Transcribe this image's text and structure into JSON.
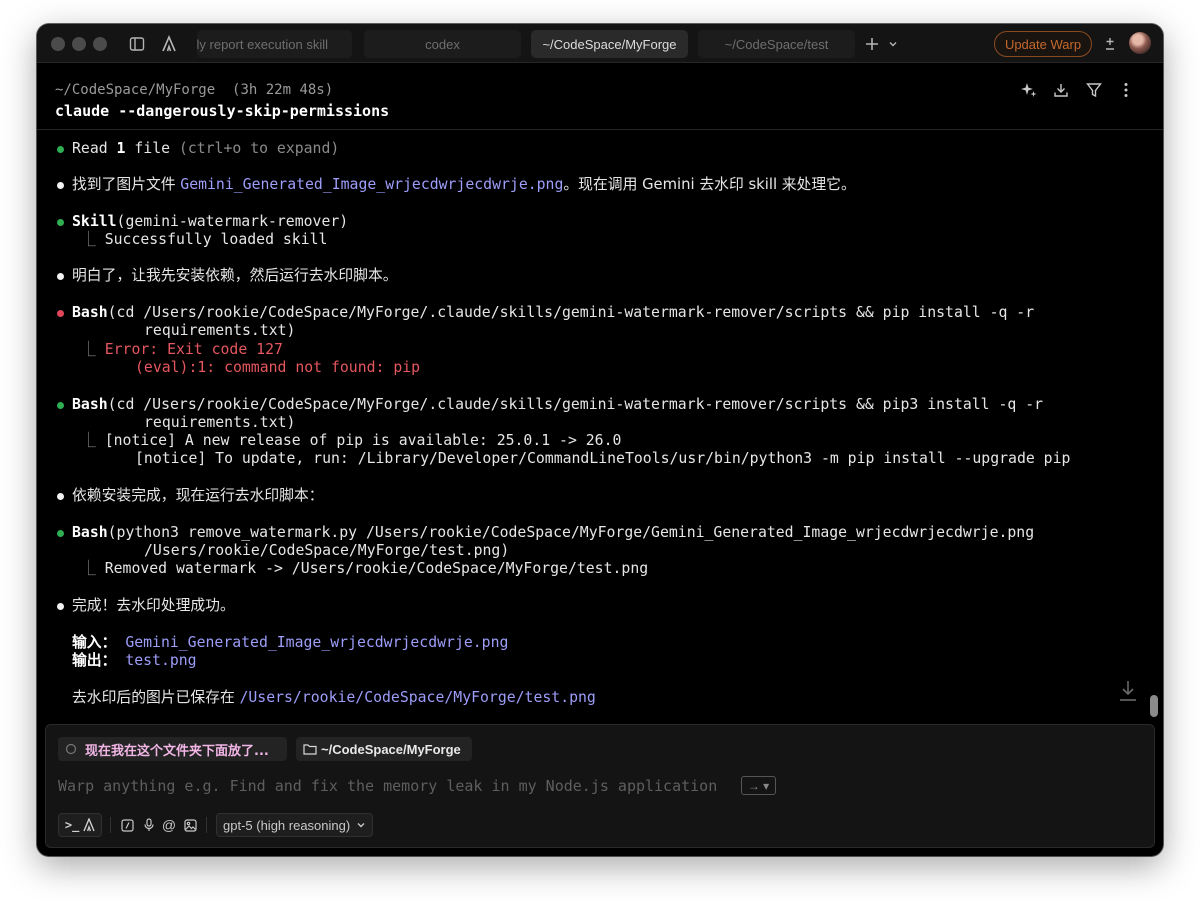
{
  "tabs": [
    {
      "label": "Daily report execution skill"
    },
    {
      "label": "codex"
    },
    {
      "label": "~/CodeSpace/MyForge"
    },
    {
      "label": "~/CodeSpace/test"
    }
  ],
  "titlebar": {
    "update_label": "Update Warp",
    "icons": [
      "sidebar-icon",
      "warp-logo-icon",
      "plus-icon",
      "chevron-down-icon",
      "plus-minus-icon",
      "avatar"
    ]
  },
  "block": {
    "path": "~/CodeSpace/MyForge",
    "duration": "(3h 22m 48s)",
    "command": "claude --dangerously-skip-permissions",
    "actions": [
      "sparkle-icon",
      "download-icon",
      "filter-icon",
      "more-vertical-icon"
    ]
  },
  "output": {
    "read": {
      "prefix": "Read ",
      "count": "1",
      "file_word": " file",
      "hint": " (ctrl+o to expand)"
    },
    "found": {
      "text": "找到了图片文件 ",
      "file": "Gemini_Generated_Image_wrjecdwrjecdwrje.png",
      "rest": "。现在调用 Gemini 去水印 skill 来处理它。"
    },
    "skill": {
      "name": "Skill",
      "arg": "(gemini-watermark-remover)",
      "result": "Successfully loaded skill"
    },
    "understand": "明白了，让我先安装依赖，然后运行去水印脚本。",
    "bash1": {
      "name": "Bash",
      "cmd1": "(cd /Users/rookie/CodeSpace/MyForge/.claude/skills/gemini-watermark-remover/scripts && pip install -q -r",
      "cmd2": "requirements.txt)",
      "err1": "Error: Exit code 127",
      "err2": "(eval):1: command not found: pip"
    },
    "bash2": {
      "name": "Bash",
      "cmd1": "(cd /Users/rookie/CodeSpace/MyForge/.claude/skills/gemini-watermark-remover/scripts && pip3 install -q -r",
      "cmd2": "requirements.txt)",
      "out1": "[notice] A new release of pip is available: 25.0.1 -> 26.0",
      "out2": "[notice] To update, run: /Library/Developer/CommandLineTools/usr/bin/python3 -m pip install --upgrade pip"
    },
    "deps_done": "依赖安装完成，现在运行去水印脚本：",
    "bash3": {
      "name": "Bash",
      "cmd1": "(python3 remove_watermark.py /Users/rookie/CodeSpace/MyForge/Gemini_Generated_Image_wrjecdwrjecdwrje.png",
      "cmd2": "/Users/rookie/CodeSpace/MyForge/test.png)",
      "result": "Removed watermark -> /Users/rookie/CodeSpace/MyForge/test.png"
    },
    "done": "完成！去水印处理成功。",
    "input_label": "输入：",
    "input_file": "Gemini_Generated_Image_wrjecdwrjecdwrje.png",
    "output_label": "输出：",
    "output_file": "test.png",
    "saved_text": "去水印后的图片已保存在 ",
    "saved_path": "/Users/rookie/CodeSpace/MyForge/test.png"
  },
  "input_area": {
    "context_chip": "现在我在这个文件夹下面放了...",
    "dir_chip": "~/CodeSpace/MyForge",
    "placeholder": "Warp anything e.g. Find and fix the memory leak in my Node.js application",
    "kbd_hint": "→ ▾",
    "model": "gpt-5 (high reasoning)"
  }
}
